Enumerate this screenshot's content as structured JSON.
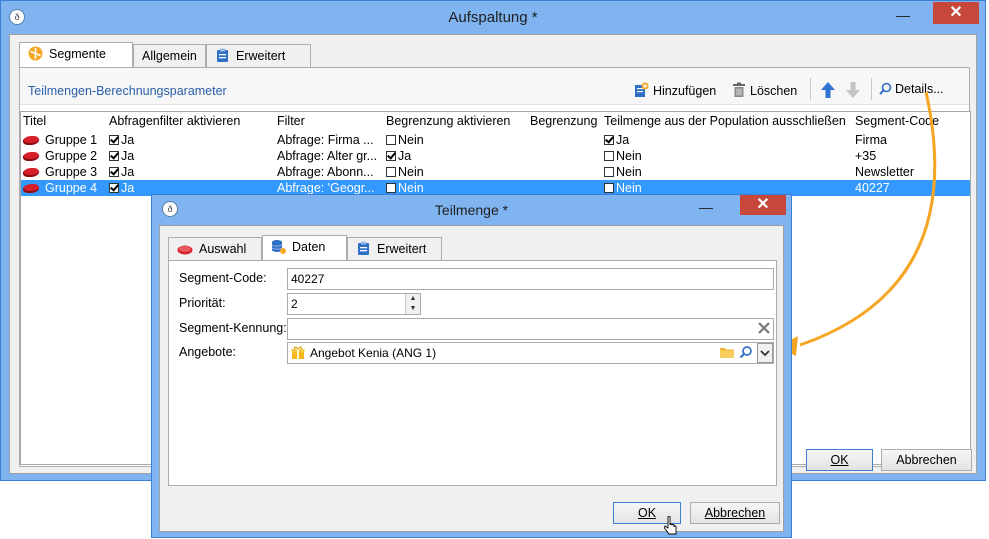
{
  "main_window": {
    "title": "Aufspaltung *",
    "min_glyph": "—",
    "close_glyph": "✕",
    "tabs": [
      {
        "label": "Segmente",
        "icon": "segments-icon"
      },
      {
        "label": "Allgemein",
        "icon": ""
      },
      {
        "label": "Erweitert",
        "icon": "clipboard-icon"
      }
    ],
    "section_title": "Teilmengen-Berechnungsparameter",
    "toolbar": {
      "add_label": "Hinzufügen",
      "delete_label": "Löschen",
      "details_label": "Details..."
    },
    "grid": {
      "columns": [
        "Titel",
        "Abfragenfilter aktivieren",
        "Filter",
        "Begrenzung aktivieren",
        "Begrenzung",
        "Teilmenge aus der Population ausschließen",
        "Segment-Code"
      ],
      "rows": [
        {
          "title": "Gruppe 1",
          "filter_on": true,
          "filter_on_label": "Ja",
          "filter": "Abfrage: Firma ...",
          "limit_on": false,
          "limit_on_label": "Nein",
          "limit": "",
          "exclude": true,
          "exclude_label": "Ja",
          "code": "Firma",
          "selected": false
        },
        {
          "title": "Gruppe 2",
          "filter_on": true,
          "filter_on_label": "Ja",
          "filter": "Abfrage: Alter gr...",
          "limit_on": true,
          "limit_on_label": "Ja",
          "limit": "",
          "exclude": false,
          "exclude_label": "Nein",
          "code": "+35",
          "selected": false
        },
        {
          "title": "Gruppe 3",
          "filter_on": true,
          "filter_on_label": "Ja",
          "filter": "Abfrage: Abonn...",
          "limit_on": false,
          "limit_on_label": "Nein",
          "limit": "",
          "exclude": false,
          "exclude_label": "Nein",
          "code": "Newsletter",
          "selected": false
        },
        {
          "title": "Gruppe 4",
          "filter_on": true,
          "filter_on_label": "Ja",
          "filter": "Abfrage: 'Geogr...",
          "limit_on": false,
          "limit_on_label": "Nein",
          "limit": "",
          "exclude": false,
          "exclude_label": "Nein",
          "code": "40227",
          "selected": true
        }
      ]
    },
    "ok_label": "OK",
    "cancel_label": "Abbrechen"
  },
  "dialog": {
    "title": "Teilmenge *",
    "min_glyph": "—",
    "close_glyph": "✕",
    "tabs": [
      {
        "label": "Auswahl",
        "icon": "segment-icon"
      },
      {
        "label": "Daten",
        "icon": "database-icon"
      },
      {
        "label": "Erweitert",
        "icon": "clipboard-icon"
      }
    ],
    "fields": {
      "segment_code_label": "Segment-Code:",
      "segment_code_value": "40227",
      "priority_label": "Priorität:",
      "priority_value": "2",
      "segment_id_label": "Segment-Kennung:",
      "segment_id_value": "",
      "offers_label": "Angebote:",
      "offers_value": "Angebot Kenia (ANG 1)"
    },
    "ok_label": "OK",
    "cancel_label": "Abbrechen"
  },
  "colors": {
    "accent_arrow": "#f5a623",
    "selection": "#3399ff",
    "link_blue": "#2a5fa8",
    "close_red": "#c7473b"
  }
}
